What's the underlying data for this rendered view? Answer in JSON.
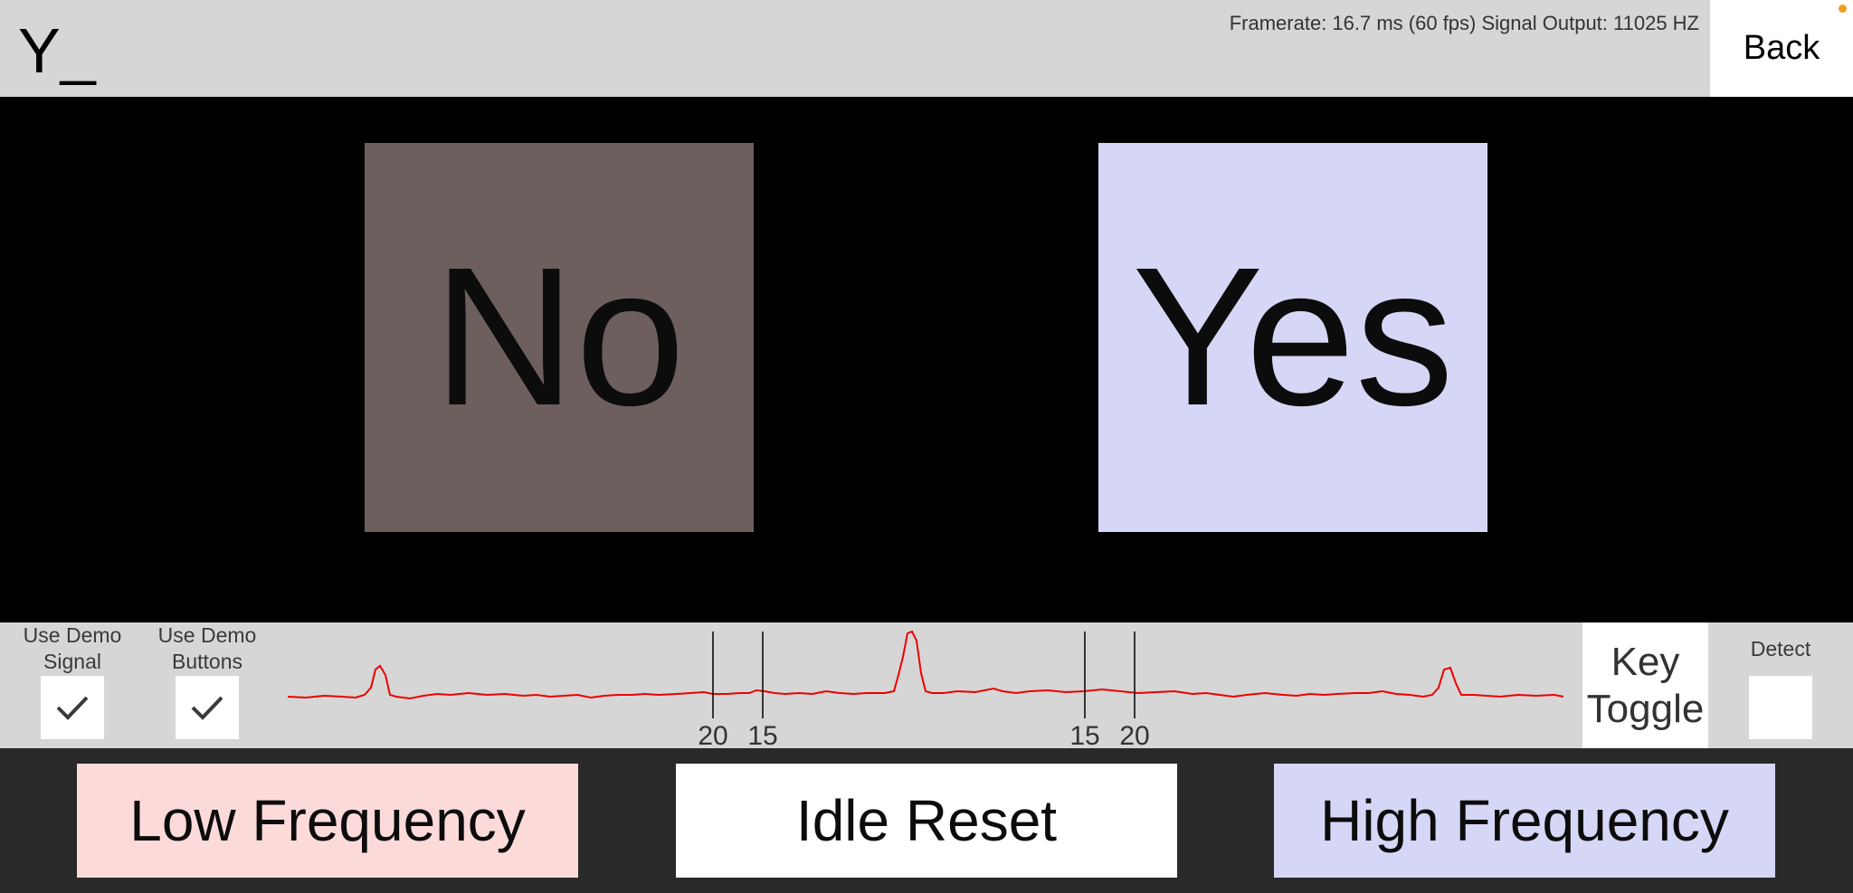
{
  "header": {
    "typed_text": "Y_",
    "status": "Framerate: 16.7 ms (60 fps) Signal Output: 11025 HZ",
    "back_label": "Back"
  },
  "choices": {
    "no_label": "No",
    "yes_label": "Yes",
    "no_color": "#6c5f5e",
    "yes_color": "#d6d6f6"
  },
  "controls": {
    "demo_signal": {
      "label_line1": "Use Demo",
      "label_line2": "Signal",
      "checked": true
    },
    "demo_buttons": {
      "label_line1": "Use Demo",
      "label_line2": "Buttons",
      "checked": true
    },
    "key_toggle_line1": "Key",
    "key_toggle_line2": "Toggle",
    "detect_label": "Detect",
    "detect_checked": false
  },
  "spectrum": {
    "line_color": "#ee0000",
    "markers": [
      "20",
      "15",
      "15",
      "20"
    ]
  },
  "buttons": {
    "low": "Low Frequency",
    "idle": "Idle Reset",
    "high": "High Frequency",
    "low_color": "#fddada",
    "high_color": "#d6d6f6"
  }
}
